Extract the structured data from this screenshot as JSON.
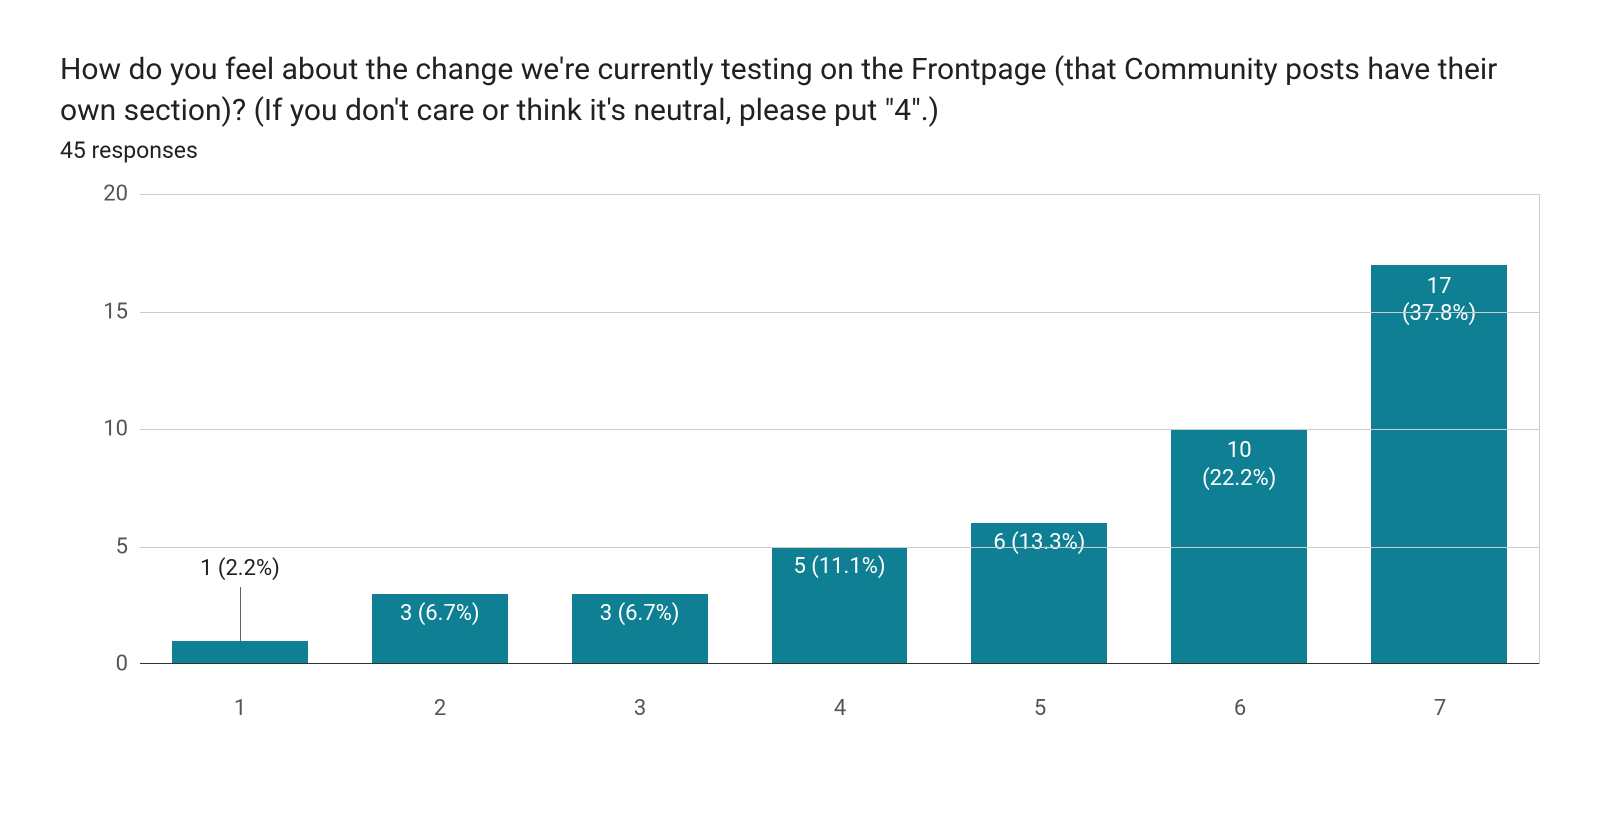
{
  "title": "How do you feel about the change we're currently testing on the Frontpage (that Community posts have their own section)? (If you don't care or think it's neutral, please put \"4\".)",
  "subtitle": "45 responses",
  "chart_data": {
    "type": "bar",
    "title": "How do you feel about the change we're currently testing on the Frontpage (that Community posts have their own section)? (If you don't care or think it's neutral, please put \"4\".)",
    "xlabel": "",
    "ylabel": "",
    "ylim": [
      0,
      20
    ],
    "y_ticks": [
      0,
      5,
      10,
      15,
      20
    ],
    "categories": [
      "1",
      "2",
      "3",
      "4",
      "5",
      "6",
      "7"
    ],
    "values": [
      1,
      3,
      3,
      5,
      6,
      10,
      17
    ],
    "percent_labels": [
      "2.2%",
      "6.7%",
      "6.7%",
      "11.1%",
      "13.3%",
      "22.2%",
      "37.8%"
    ],
    "bar_color": "#0f8094"
  }
}
